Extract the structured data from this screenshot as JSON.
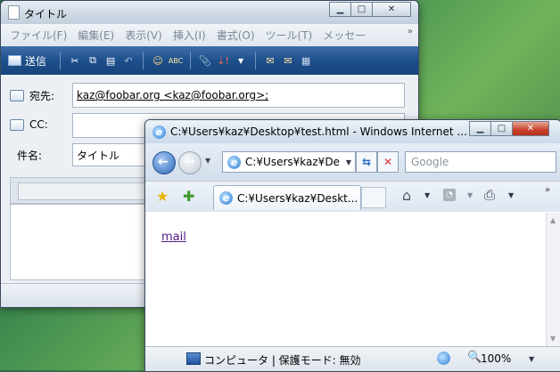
{
  "mail": {
    "title": "タイトル",
    "menu": [
      "ファイル(F)",
      "編集(E)",
      "表示(V)",
      "挿入(I)",
      "書式(O)",
      "ツール(T)",
      "メッセー"
    ],
    "send_label": "送信",
    "to_label": "宛先:",
    "to_value": "kaz@foobar.org <kaz@foobar.org>;",
    "cc_label": "CC:",
    "cc_value": "",
    "subject_label": "件名:",
    "subject_value": "タイトル"
  },
  "ie": {
    "title": "C:¥Users¥kaz¥Desktop¥test.html - Windows Internet ...",
    "address": "C:¥Users¥kaz¥De",
    "search_placeholder": "Google",
    "tab_label": "C:¥Users¥kaz¥Deskt...",
    "link_text": "mail",
    "status_zone": "コンピュータ | 保護モード: 無効",
    "zoom": "100%"
  },
  "colors": {
    "toolbar_blue": "#1d4f8c",
    "close_red": "#c7402a",
    "link_visited": "#551a8b"
  }
}
